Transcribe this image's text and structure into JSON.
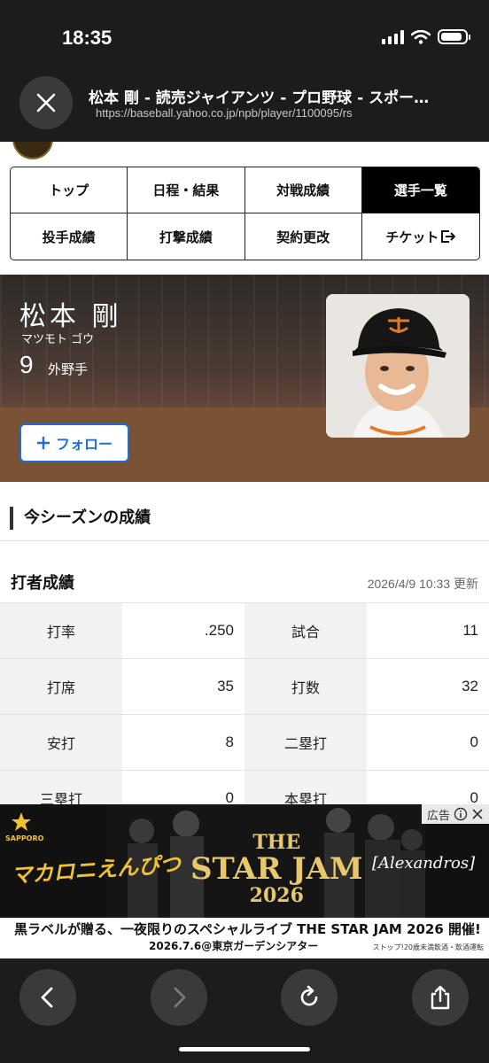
{
  "status": {
    "time": "18:35",
    "battery_level": 0.9
  },
  "browser": {
    "title": "松本 剛 - 読売ジャイアンツ - プロ野球 - スポー…",
    "url": "https://baseball.yahoo.co.jp/npb/player/1100095/rs"
  },
  "nav": {
    "items": [
      "トップ",
      "日程・結果",
      "対戦成績",
      "選手一覧",
      "投手成績",
      "打撃成績",
      "契約更改",
      "チケット"
    ],
    "active": "選手一覧"
  },
  "player": {
    "name": "松本 剛",
    "kana": "マツモト ゴウ",
    "number": "9",
    "position": "外野手",
    "follow_label": "フォロー"
  },
  "season": {
    "section_title": "今シーズンの成績",
    "batting_title": "打者成績",
    "updated": "2026/4/9 10:33 更新",
    "rows": [
      [
        {
          "label": "打率",
          "value": ".250"
        },
        {
          "label": "試合",
          "value": "11"
        }
      ],
      [
        {
          "label": "打席",
          "value": "35"
        },
        {
          "label": "打数",
          "value": "32"
        }
      ],
      [
        {
          "label": "安打",
          "value": "8"
        },
        {
          "label": "二塁打",
          "value": "0"
        }
      ],
      [
        {
          "label": "三塁打",
          "value": "0"
        },
        {
          "label": "本塁打",
          "value": "0"
        }
      ]
    ]
  },
  "ad": {
    "badge": "広告",
    "sponsor": "SAPPORO",
    "brand": "マカロニえんぴつ",
    "event": "STAR JAM",
    "year": "2026",
    "event_prefix": "THE",
    "artist": "[Alexandros]",
    "headline": "黒ラベルが贈る、一夜限りのスペシャルライブ THE STAR JAM 2026 開催!",
    "date_venue": "2026.7.6@東京ガーデンシアター",
    "note": "ストップ!20歳未満飲酒・飲酒運転"
  },
  "colors": {
    "accent": "#1f6fd6",
    "chrome": "#1c1c1e"
  }
}
